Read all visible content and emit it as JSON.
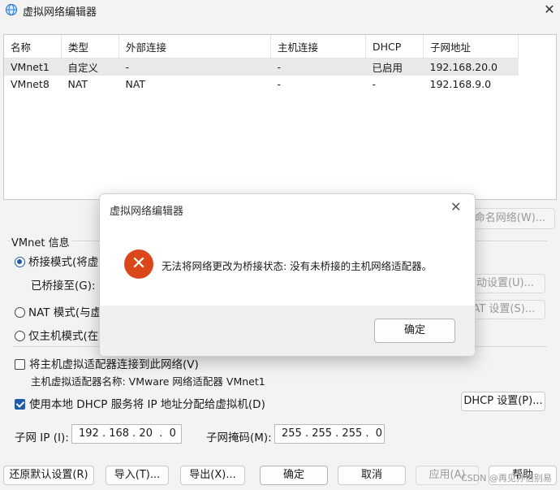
{
  "window": {
    "title": "虚拟网络编辑器",
    "close_glyph": "✕"
  },
  "table": {
    "columns": [
      "名称",
      "类型",
      "外部连接",
      "主机连接",
      "DHCP",
      "子网地址"
    ],
    "rows": [
      [
        "VMnet1",
        "自定义",
        "-",
        "-",
        "已启用",
        "192.168.20.0"
      ],
      [
        "VMnet8",
        "NAT",
        "NAT",
        "-",
        "-",
        "192.168.9.0"
      ]
    ]
  },
  "rename_button": "重命名网络(W)...",
  "vmnet_info": {
    "label": "VMnet 信息",
    "bridged": "桥接模式(将虚",
    "bridged_to": "已桥接至(G):",
    "auto_button": "自动设置(U)...",
    "nat": "NAT 模式(与虚",
    "nat_button": "NAT 设置(S)...",
    "hostonly": "仅主机模式(在",
    "connect_adapter": "将主机虚拟适配器连接到此网络(V)",
    "adapter_name": "主机虚拟适配器名称: VMware 网络适配器 VMnet1",
    "use_dhcp": "使用本地 DHCP 服务将 IP 地址分配给虚拟机(D)",
    "dhcp_button": "DHCP 设置(P)...",
    "subnet_ip_label": "子网 IP (I):",
    "subnet_ip": "192 . 168 . 20  .  0",
    "subnet_mask_label": "子网掩码(M):",
    "subnet_mask": "255 . 255 . 255 .  0"
  },
  "bottom_buttons": {
    "restore": "还原默认设置(R)",
    "import": "导入(T)...",
    "export": "导出(X)...",
    "ok": "确定",
    "cancel": "取消",
    "apply": "应用(A)",
    "help": "帮助"
  },
  "dialog": {
    "title": "虚拟网络编辑器",
    "close_glyph": "✕",
    "icon": "error-x-icon",
    "message": "无法将网络更改为桥接状态: 没有未桥接的主机网络适配器。",
    "ok": "确定"
  },
  "watermark": "CSDN @再见孙悟别易",
  "colors": {
    "error": "#d9471b",
    "accent": "#1f5aa6"
  }
}
